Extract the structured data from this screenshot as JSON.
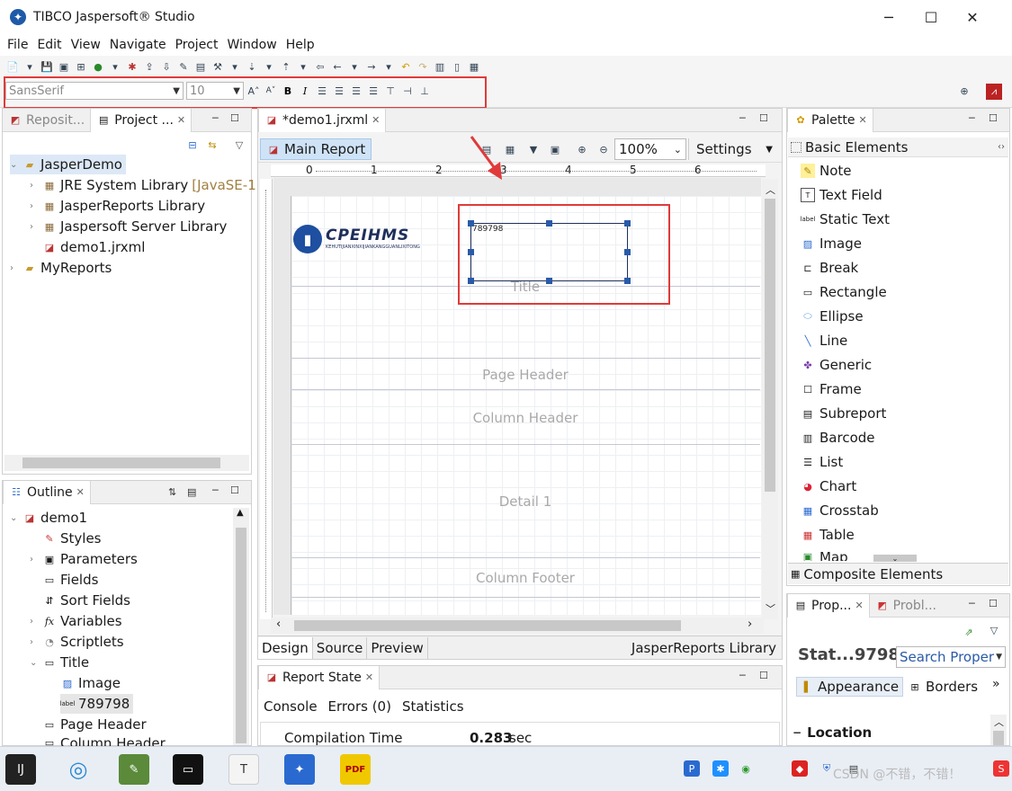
{
  "window": {
    "title": "TIBCO Jaspersoft® Studio",
    "minimize": "─",
    "maximize": "☐",
    "close": "✕"
  },
  "menu": [
    "File",
    "Edit",
    "View",
    "Navigate",
    "Project",
    "Window",
    "Help"
  ],
  "format_toolbar": {
    "font_family": "SansSerif",
    "font_size": "10",
    "bold": "B",
    "italic": "I"
  },
  "left_top": {
    "tabs": [
      "Reposit...",
      "Project ..."
    ],
    "tree": [
      {
        "label": "JasperDemo",
        "level": 0
      },
      {
        "label": "JRE System Library",
        "suffix": "[JavaSE-1.",
        "level": 1
      },
      {
        "label": "JasperReports Library",
        "level": 1
      },
      {
        "label": "Jaspersoft Server Library",
        "level": 1
      },
      {
        "label": "demo1.jrxml",
        "level": 1
      },
      {
        "label": "MyReports",
        "level": 0
      }
    ]
  },
  "outline": {
    "tab": "Outline",
    "tree": [
      "demo1",
      "Styles",
      "Parameters",
      "Fields",
      "Sort Fields",
      "Variables",
      "Scriptlets",
      "Title",
      "Image",
      "789798",
      "Page Header",
      "Column Header"
    ]
  },
  "editor": {
    "tab": "*demo1.jrxml",
    "main_report": "Main Report",
    "zoom": "100%",
    "settings": "Settings",
    "ruler": [
      "0",
      "1",
      "2",
      "3",
      "4",
      "5",
      "6"
    ],
    "logo_text": "CPEIHMS",
    "logo_sub": "KEHUTIJIANXINXIJIANKANGGUANLIXITONG",
    "element_text": "789798",
    "bands": [
      "Title",
      "Page Header",
      "Column Header",
      "Detail 1",
      "Column Footer"
    ],
    "bottom_tabs": [
      "Design",
      "Source",
      "Preview"
    ],
    "library": "JasperReports Library"
  },
  "report_state": {
    "tab": "Report State",
    "tabs": [
      "Console",
      "Errors (0)",
      "Statistics"
    ],
    "row_label": "Compilation Time",
    "row_value": "0.283",
    "row_unit": "sec"
  },
  "palette": {
    "tab": "Palette",
    "section": "Basic Elements",
    "items": [
      "Note",
      "Text Field",
      "Static Text",
      "Image",
      "Break",
      "Rectangle",
      "Ellipse",
      "Line",
      "Generic",
      "Frame",
      "Subreport",
      "Barcode",
      "List",
      "Chart",
      "Crosstab",
      "Table",
      "Map"
    ],
    "composite": "Composite Elements"
  },
  "properties": {
    "tabs": [
      "Prop...",
      "Probl..."
    ],
    "element": "Stat...9798",
    "search": "Search Proper",
    "sub_tabs": [
      "Appearance",
      "Borders"
    ],
    "section": "Location"
  },
  "taskbar": {
    "tray_text": "CSDN @不错，不错！"
  },
  "colors": {
    "highlight_red": "#e03a3a",
    "selection_blue": "#cfe3f7",
    "canvas_grid": "#e6e9ef"
  }
}
